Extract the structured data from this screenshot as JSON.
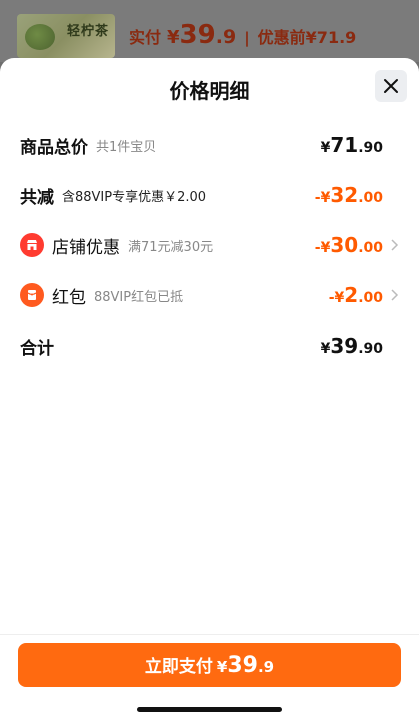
{
  "header": {
    "thumb_label": "轻柠茶",
    "paid_label": "实付",
    "yuan": "¥",
    "price_int": "39",
    "price_dec": ".9",
    "separator": "|",
    "original_label": "优惠前¥71.9"
  },
  "sheet": {
    "title": "价格明细",
    "rows": [
      {
        "label": "商品总价",
        "sub": "共1件宝贝",
        "yuan": "¥",
        "int": "71",
        "dec": ".90"
      },
      {
        "label": "共减",
        "sub": "含88VIP专享优惠￥2.00",
        "yuan": "-¥",
        "int": "32",
        "dec": ".00"
      },
      {
        "label": "店铺优惠",
        "sub": "满71元减30元",
        "yuan": "-¥",
        "int": "30",
        "dec": ".00",
        "icon": "store-icon"
      },
      {
        "label": "红包",
        "sub": "88VIP红包已抵",
        "yuan": "-¥",
        "int": "2",
        "dec": ".00",
        "icon": "red-packet-icon"
      },
      {
        "label": "合计",
        "yuan": "¥",
        "int": "39",
        "dec": ".90"
      }
    ]
  },
  "footer": {
    "pay_label": "立即支付",
    "yuan": "¥",
    "int": "39",
    "dec": ".9"
  },
  "colors": {
    "accent": "#ff6a10",
    "discount": "#ff5a00",
    "badge_red": "#ff3b30"
  }
}
